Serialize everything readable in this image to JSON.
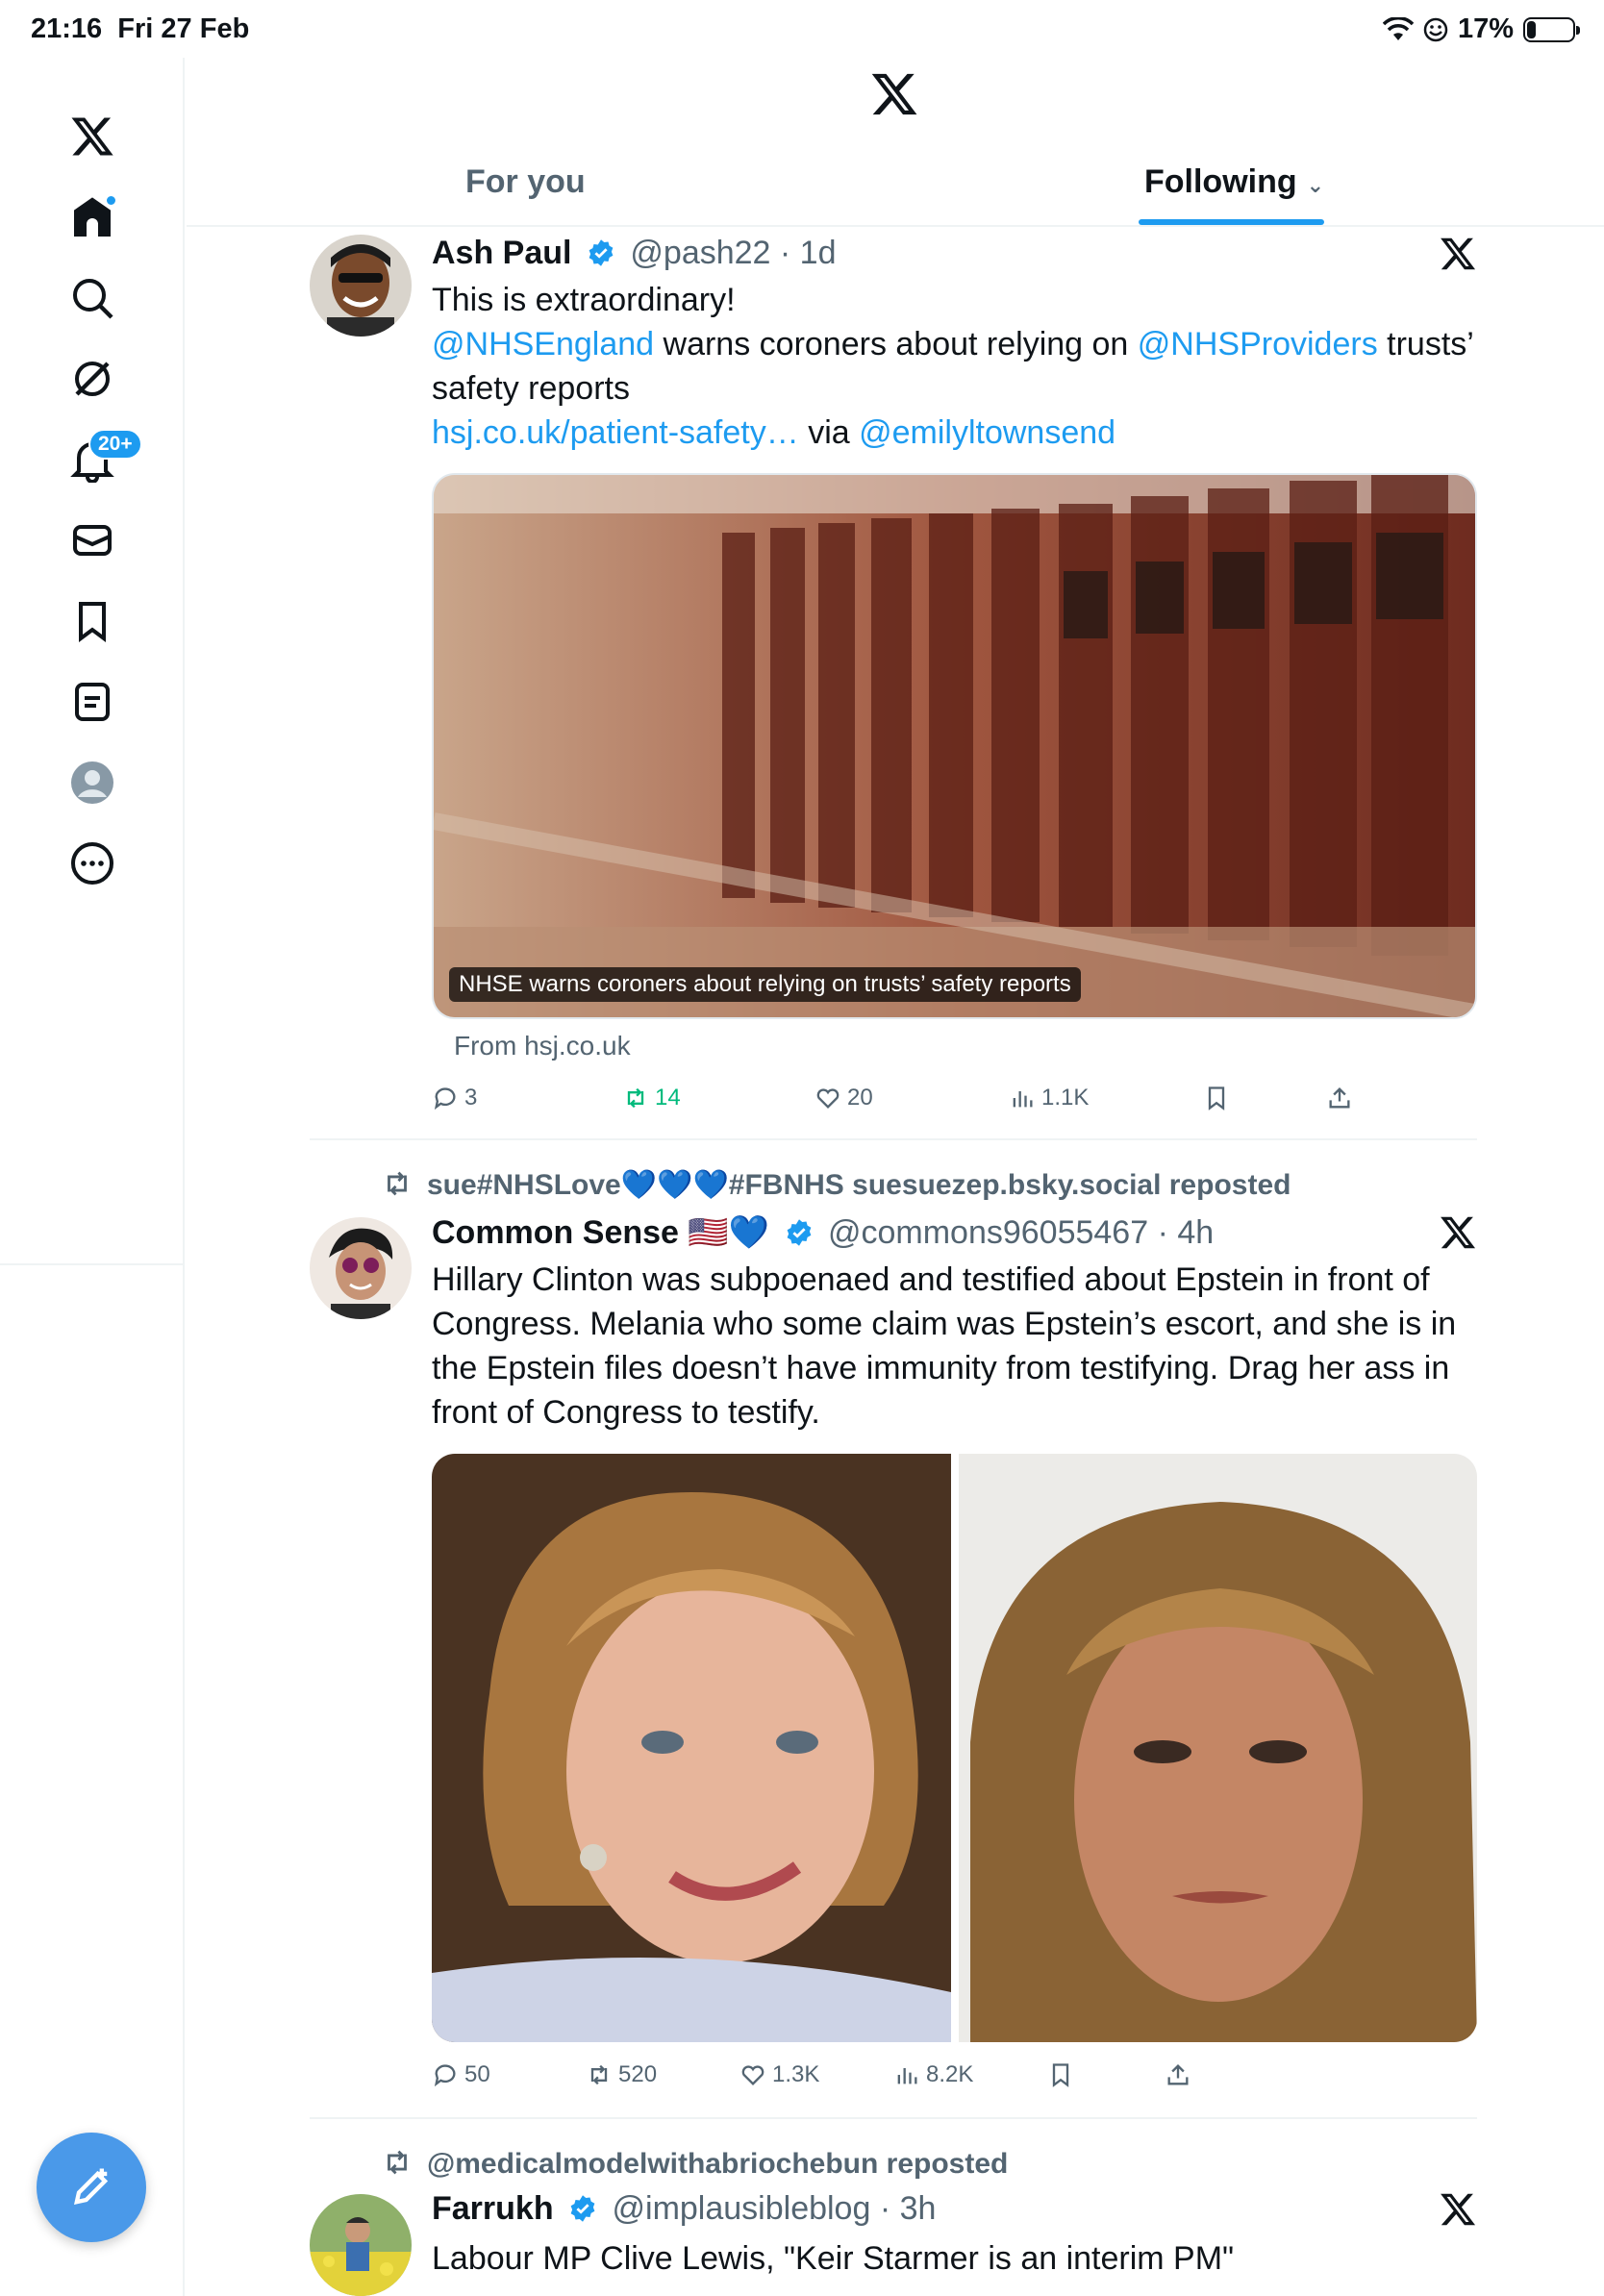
{
  "status": {
    "time": "21:16",
    "date": "Fri 27 Feb",
    "battery": "17%",
    "battery_level": 0.17
  },
  "sidebar": {
    "items": [
      {
        "name": "x-logo-icon"
      },
      {
        "name": "home-icon",
        "active": true
      },
      {
        "name": "search-icon"
      },
      {
        "name": "grok-icon"
      },
      {
        "name": "notifications-icon",
        "badge": "20+"
      },
      {
        "name": "messages-icon"
      },
      {
        "name": "bookmarks-icon"
      },
      {
        "name": "lists-icon"
      },
      {
        "name": "profile-icon"
      },
      {
        "name": "more-icon"
      }
    ],
    "compose_icon": "compose-icon"
  },
  "header": {
    "tabs": [
      {
        "label": "For you",
        "selected": false
      },
      {
        "label": "Following",
        "selected": true
      }
    ]
  },
  "tweets": [
    {
      "name": "Ash Paul",
      "handle": "@pash22",
      "time": "· 1d",
      "text_line1": "This is extraordinary!",
      "mention1": "@NHSEngland",
      "text_mid": " warns coroners about relying on ",
      "mention2": "@NHSProviders",
      "text_end": " trusts’",
      "text_line3": "safety reports",
      "link": "hsj.co.uk/patient-safety…",
      "via": " via ",
      "mention3": "@emilyltownsend",
      "card_caption": "NHSE warns coroners about relying on trusts’ safety reports",
      "card_source": "From hsj.co.uk",
      "stats": {
        "replies": "3",
        "reposts": "14",
        "likes": "20",
        "views": "1.1K"
      }
    },
    {
      "repost_by": "sue#NHSLove💙💙💙#FBNHS suesuezep.bsky.social reposted",
      "name": "Common Sense 🇺🇸💙",
      "handle": "@commons96055467",
      "time": "· 4h",
      "text": "Hillary Clinton was subpoenaed and testified about Epstein in front of Congress. Melania who some claim was Epstein’s escort, and she is in the Epstein files doesn’t have immunity from testifying. Drag her ass in front of Congress to testify.",
      "stats": {
        "replies": "50",
        "reposts": "520",
        "likes": "1.3K",
        "views": "8.2K"
      }
    },
    {
      "repost_by": "@medicalmodelwithabriochebun reposted",
      "name": "Farrukh",
      "handle": "@implausibleblog",
      "time": "· 3h",
      "text": "Labour MP Clive Lewis, \"Keir Starmer is an interim PM\""
    }
  ],
  "colors": {
    "accent": "#1d9bf0",
    "secondary_text": "#536471",
    "retweet_green": "#00ba7c"
  }
}
